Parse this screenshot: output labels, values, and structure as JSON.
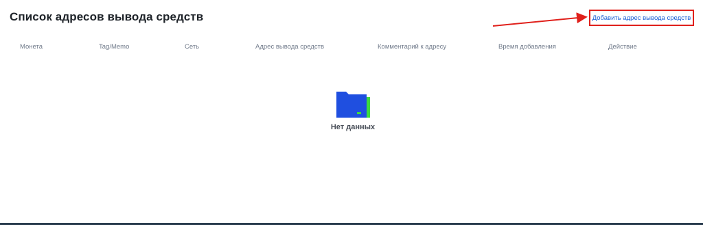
{
  "header": {
    "title": "Список адресов вывода средств",
    "add_link_label": "Добавить адрес вывода средств"
  },
  "table": {
    "columns": [
      "Монета",
      "Tag/Memo",
      "Сеть",
      "Адрес вывода средств",
      "Комментарий к адресу",
      "Время добавления",
      "Действие"
    ]
  },
  "empty_state": {
    "text": "Нет данных",
    "icon": "folder-icon"
  },
  "colors": {
    "link": "#1a5fd6",
    "highlight": "#e0201b",
    "folder": "#1f4fe0",
    "folder_accent": "#3ddc3d"
  }
}
